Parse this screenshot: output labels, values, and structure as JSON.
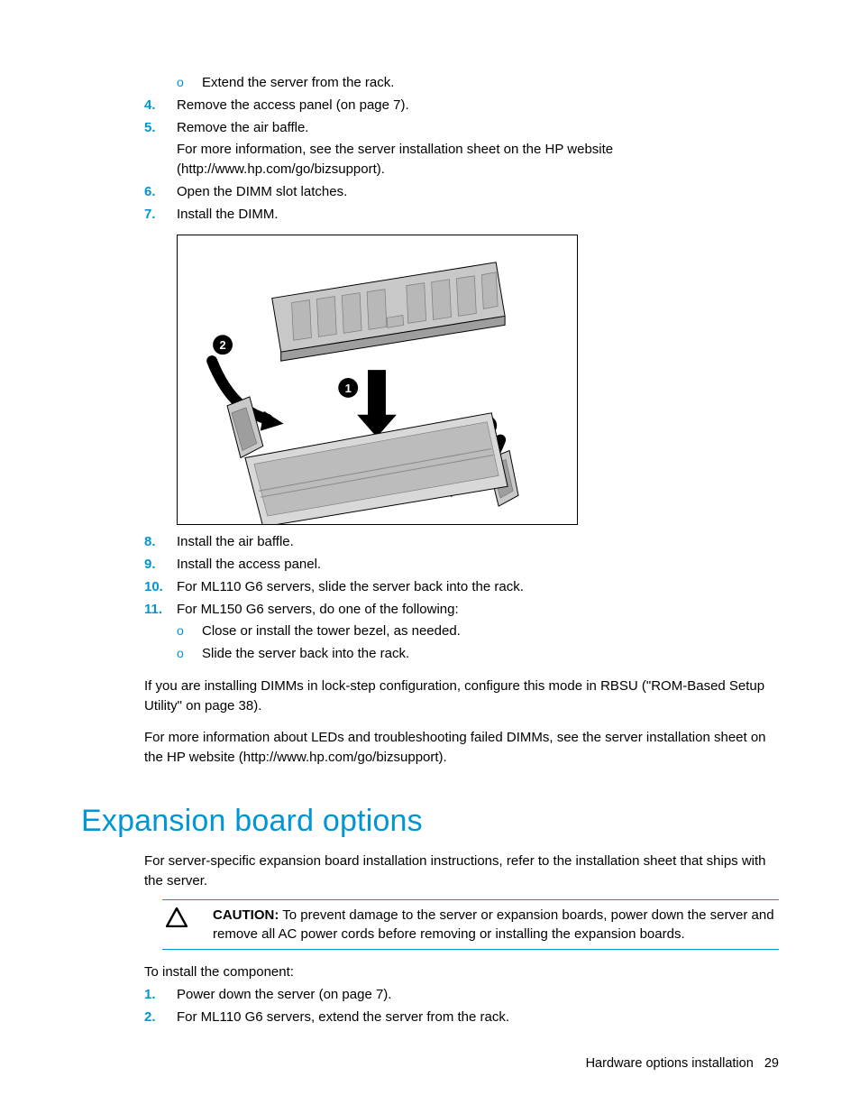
{
  "list1": {
    "sub_o": "o",
    "sub_extend": "Extend the server from the rack.",
    "n4": "4.",
    "t4": "Remove the access panel (on page 7).",
    "n5": "5.",
    "t5": "Remove the air baffle.",
    "t5_extra": "For more information, see the server installation sheet on the HP website (http://www.hp.com/go/bizsupport).",
    "n6": "6.",
    "t6": "Open the DIMM slot latches.",
    "n7": "7.",
    "t7": "Install the DIMM."
  },
  "figure": {
    "alt": "DIMM installation diagram",
    "c1": "1",
    "c2a": "2",
    "c2b": "2"
  },
  "list2": {
    "n8": "8.",
    "t8": "Install the air baffle.",
    "n9": "9.",
    "t9": "Install the access panel.",
    "n10": "10.",
    "t10": "For ML110 G6 servers, slide the server back into the rack.",
    "n11": "11.",
    "t11": "For ML150 G6 servers, do one of the following:",
    "sub_o": "o",
    "sub_a": "Close or install the tower bezel, as needed.",
    "sub_b": "Slide the server back into the rack."
  },
  "para1": "If you are installing DIMMs in lock-step configuration, configure this mode in RBSU (\"ROM-Based Setup Utility\" on page 38).",
  "para2": "For more information about LEDs and troubleshooting failed DIMMs, see the server installation sheet on the HP website (http://www.hp.com/go/bizsupport).",
  "section2": {
    "heading": "Expansion board options",
    "intro": "For server-specific expansion board installation instructions, refer to the installation sheet that ships with the server.",
    "caution_label": "CAUTION:",
    "caution_text": "  To prevent damage to the server or expansion boards, power down the server and remove all AC power cords before removing or installing the expansion boards.",
    "lead": "To install the component:",
    "n1": "1.",
    "t1": "Power down the server (on page 7).",
    "n2": "2.",
    "t2": "For ML110 G6 servers, extend the server from the rack."
  },
  "footer": {
    "text": "Hardware options installation",
    "page": "29"
  }
}
